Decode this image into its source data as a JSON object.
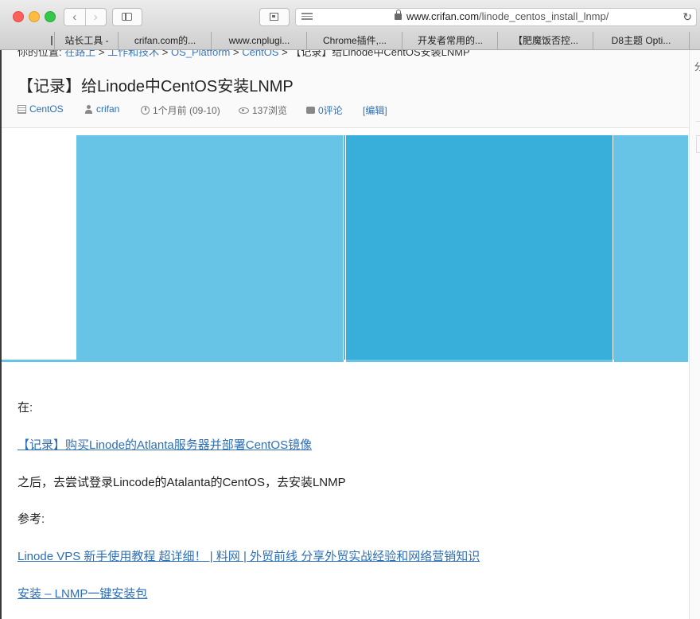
{
  "browser": {
    "url_domain": "www.crifan.com",
    "url_path": "/linode_centos_install_lnmp/"
  },
  "bookmarks": [
    "站长工具 -",
    "crifan.com的...",
    "www.cnplugi...",
    "Chrome插件,...",
    "开发者常用的...",
    "【肥魔饭否控...",
    "D8主题 Opti..."
  ],
  "breadcrumb": {
    "prefix": "你的位置:",
    "items": [
      "在路上",
      "工作和技术",
      "OS_Platform",
      "CentOS"
    ],
    "current": "【记录】给Linode中CentOS安装LNMP",
    "separator": ">"
  },
  "post": {
    "title": "【记录】给Linode中CentOS安装LNMP",
    "category": "CentOS",
    "author": "crifan",
    "date": "1个月前 (09-10)",
    "views": "137浏览",
    "comments": "0评论",
    "edit": "[编辑]"
  },
  "right_rail": {
    "label": "分"
  },
  "content": {
    "p1": "在:",
    "link1": "【记录】购买Linode的Atlanta服务器并部署CentOS镜像",
    "p2": "之后，去尝试登录Lincode的Atalanta的CentOS，去安装LNMP",
    "p3": "参考:",
    "link2": "Linode VPS 新手使用教程 超详细！ | 料网 | 外贸前线  分享外贸实战经验和网络营销知识",
    "link3": "安装 – LNMP一键安装包"
  }
}
